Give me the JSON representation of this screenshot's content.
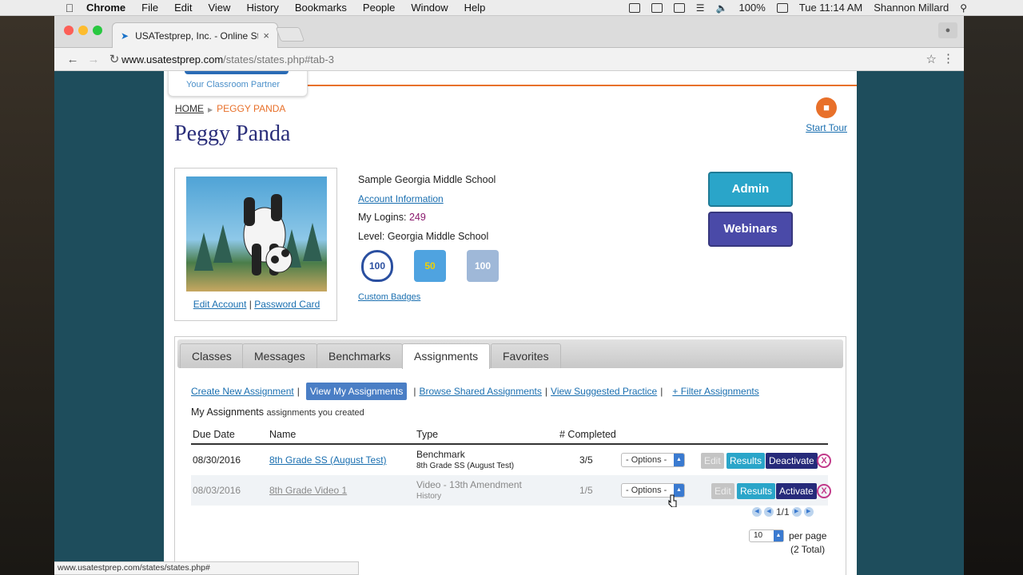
{
  "menubar": {
    "app": "Chrome",
    "items": [
      "File",
      "Edit",
      "View",
      "History",
      "Bookmarks",
      "People",
      "Window",
      "Help"
    ],
    "battery": "100%",
    "clock": "Tue 11:14 AM",
    "user": "Shannon Millard"
  },
  "browser": {
    "tab_title": "USATestprep, Inc. - Online Sta",
    "url_host": "www.usatestprep.com",
    "url_path": "/states/states.php#tab-3",
    "status_url": "www.usatestprep.com/states/states.php#"
  },
  "logo": {
    "tagline": "Your Classroom Partner"
  },
  "breadcrumb": {
    "home": "HOME",
    "current": "PEGGY PANDA"
  },
  "page_title": "Peggy Panda",
  "tour": {
    "label": "Start Tour"
  },
  "profile": {
    "edit_account": "Edit Account",
    "separator": "|",
    "password_card": "Password Card",
    "school": "Sample Georgia Middle School",
    "account_info": "Account Information",
    "logins_label": "My Logins:",
    "logins_value": "249",
    "level": "Level: Georgia Middle School",
    "badges": [
      "100",
      "50",
      "100"
    ],
    "custom_badges": "Custom Badges"
  },
  "buttons": {
    "admin": "Admin",
    "webinars": "Webinars"
  },
  "tabs": [
    "Classes",
    "Messages",
    "Benchmarks",
    "Assignments",
    "Favorites"
  ],
  "actions": {
    "create": "Create New Assignment",
    "view_mine": "View My Assignments",
    "browse": "Browse Shared Assignments",
    "suggested": "View Suggested Practice",
    "filter": "+ Filter Assignments",
    "pipe": "|"
  },
  "list": {
    "title": "My Assignments",
    "subtitle": "assignments you created",
    "columns": [
      "Due Date",
      "Name",
      "Type",
      "# Completed"
    ],
    "rows": [
      {
        "due": "08/30/2016",
        "name": "8th Grade SS (August Test)",
        "type": "Benchmark",
        "type_sub": "8th Grade SS (August Test)",
        "completed": "3/5",
        "options": "- Options -",
        "edit": "Edit",
        "results": "Results",
        "toggle": "Deactivate"
      },
      {
        "due": "08/03/2016",
        "name": "8th Grade Video 1",
        "type": "Video - 13th Amendment",
        "type_sub": "History",
        "completed": "1/5",
        "options": "- Options -",
        "edit": "Edit",
        "results": "Results",
        "toggle": "Activate"
      }
    ],
    "pager": "1/1",
    "per_page_value": "10",
    "per_page_label": "per page",
    "total": "(2 Total)"
  }
}
